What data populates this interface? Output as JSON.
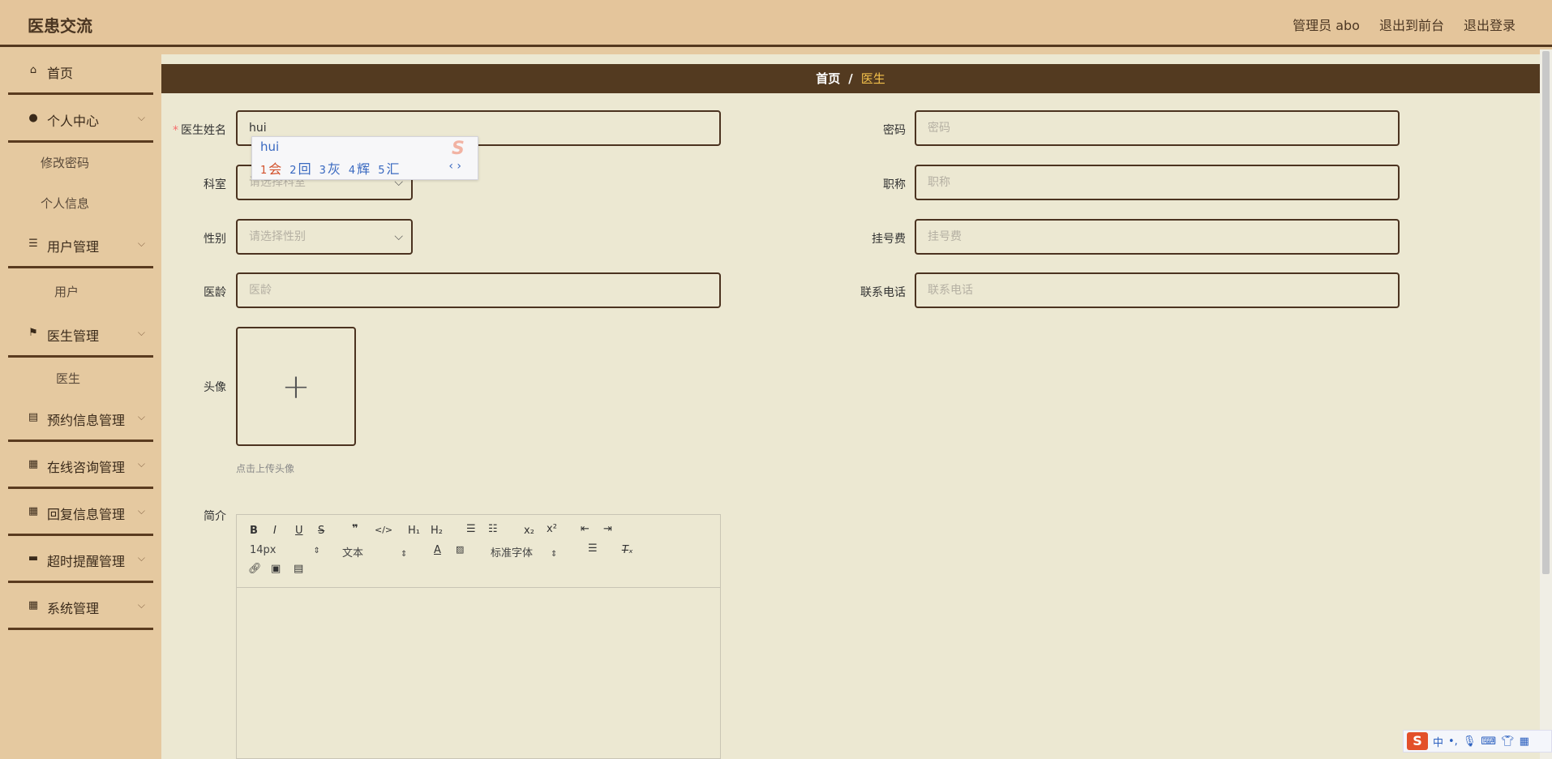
{
  "header": {
    "title": "医患交流",
    "admin_label": "管理员 abo",
    "to_front": "退出到前台",
    "logout": "退出登录"
  },
  "sidebar": {
    "home": "首页",
    "personal_center": "个人中心",
    "change_password": "修改密码",
    "personal_info": "个人信息",
    "user_mgmt": "用户管理",
    "user": "用户",
    "doctor_mgmt": "医生管理",
    "doctor": "医生",
    "appointment_mgmt": "预约信息管理",
    "consult_mgmt": "在线咨询管理",
    "reply_mgmt": "回复信息管理",
    "timeout_mgmt": "超时提醒管理",
    "system_mgmt": "系统管理"
  },
  "breadcrumb": {
    "home": "首页",
    "separator": "/",
    "current": "医生"
  },
  "form": {
    "name_label": "医生姓名",
    "name_value": "hui",
    "password_label": "密码",
    "password_placeholder": "密码",
    "dept_label": "科室",
    "dept_placeholder": "请选择科室",
    "title_label": "职称",
    "title_placeholder": "职称",
    "gender_label": "性别",
    "gender_placeholder": "请选择性别",
    "fee_label": "挂号费",
    "fee_placeholder": "挂号费",
    "years_label": "医龄",
    "years_placeholder": "医龄",
    "phone_label": "联系电话",
    "phone_placeholder": "联系电话",
    "avatar_label": "头像",
    "avatar_tip": "点击上传头像",
    "intro_label": "简介"
  },
  "editor": {
    "font_size": "14px",
    "block_type": "文本",
    "font_family": "标准字体"
  },
  "ime": {
    "composition": "hui",
    "candidates": [
      {
        "n": "1",
        "c": "会"
      },
      {
        "n": "2",
        "c": "回"
      },
      {
        "n": "3",
        "c": "灰"
      },
      {
        "n": "4",
        "c": "辉"
      },
      {
        "n": "5",
        "c": "汇"
      }
    ]
  },
  "tray": {
    "mode": "中"
  },
  "colors": {
    "header_bg": "#e4c59b",
    "breadcrumb_bg": "#533a20",
    "breadcrumb_current": "#f3c14b",
    "main_bg": "#ece8d2",
    "border": "#4b3320"
  }
}
